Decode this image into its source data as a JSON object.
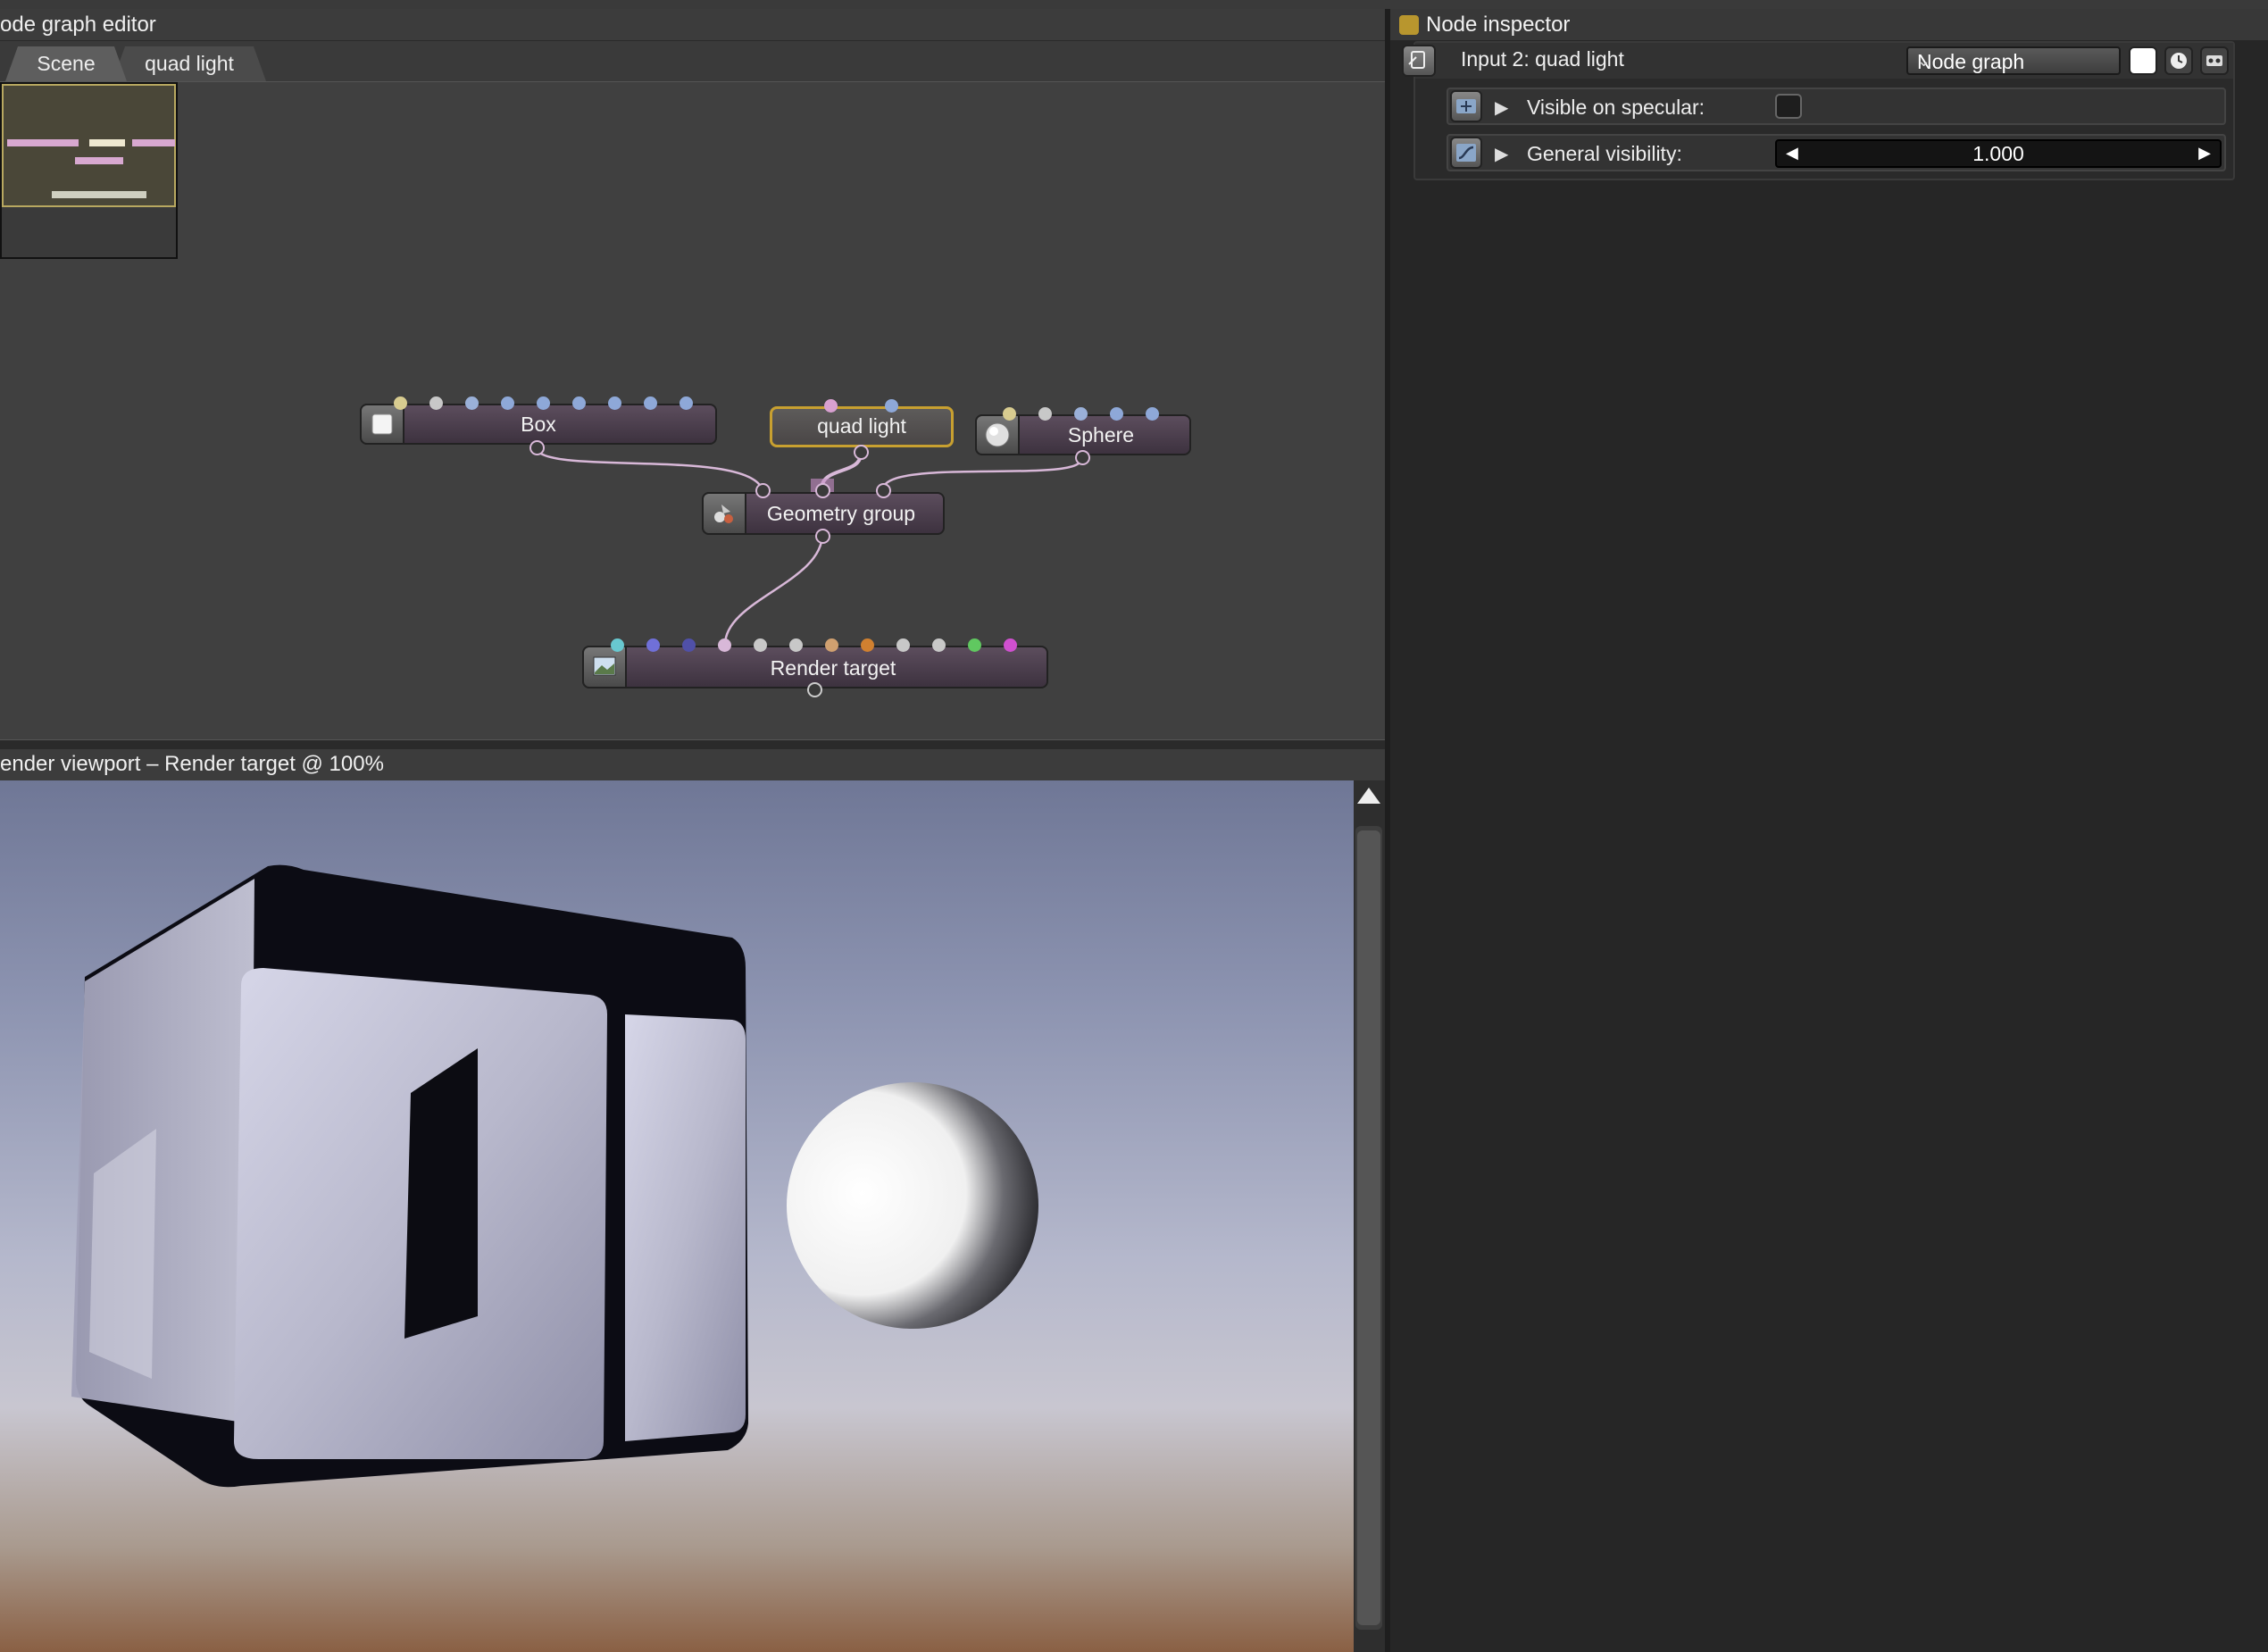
{
  "node_graph": {
    "title": "ode graph editor",
    "tabs": [
      {
        "label": "Scene"
      },
      {
        "label": "quad light"
      }
    ],
    "nodes": {
      "box": {
        "label": "Box"
      },
      "quad_light": {
        "label": "quad light"
      },
      "sphere": {
        "label": "Sphere"
      },
      "geometry_group": {
        "label": "Geometry group"
      },
      "render_target": {
        "label": "Render target"
      }
    },
    "pin_colors": {
      "box": [
        "#d8cc90",
        "#c8c8c8",
        "#9ab0d8",
        "#8ea8d8",
        "#8ea8d8",
        "#8ea8d8",
        "#8ea8d8",
        "#8ea8d8",
        "#8ea8d8"
      ],
      "quad_light": [
        "#d8a0d0",
        "#8ea8d8"
      ],
      "sphere": [
        "#d8cc90",
        "#c8c8c8",
        "#9ab0d8",
        "#8ea8d8",
        "#8ea8d8"
      ],
      "render_target": [
        "#68c8d0",
        "#7070d8",
        "#5050a8",
        "#d8b8d8",
        "#c8c8c8",
        "#c8c8c8",
        "#d0a070",
        "#d08030",
        "#c8c8c8",
        "#c8c8c8",
        "#60c860",
        "#d050d0"
      ]
    },
    "link_color": "#d8b8d8",
    "selected_border": "#c8a030"
  },
  "viewport": {
    "title": "ender viewport – Render target @ 100%"
  },
  "inspector": {
    "title": "Node inspector",
    "header_label": "Input 2: quad light",
    "dropdown_value": "Node graph",
    "rows": [
      {
        "label": "Visible on specular:"
      },
      {
        "label": "General visibility:",
        "value": "1.000"
      }
    ],
    "accent": "#b8962e"
  },
  "icons": [
    "graph-icon",
    "node-group-icon",
    "curve-icon",
    "clock-icon",
    "record-icon",
    "cube-icon",
    "sphere-icon",
    "geometry-group-icon",
    "render-target-icon",
    "collapse-arrow-icon"
  ]
}
